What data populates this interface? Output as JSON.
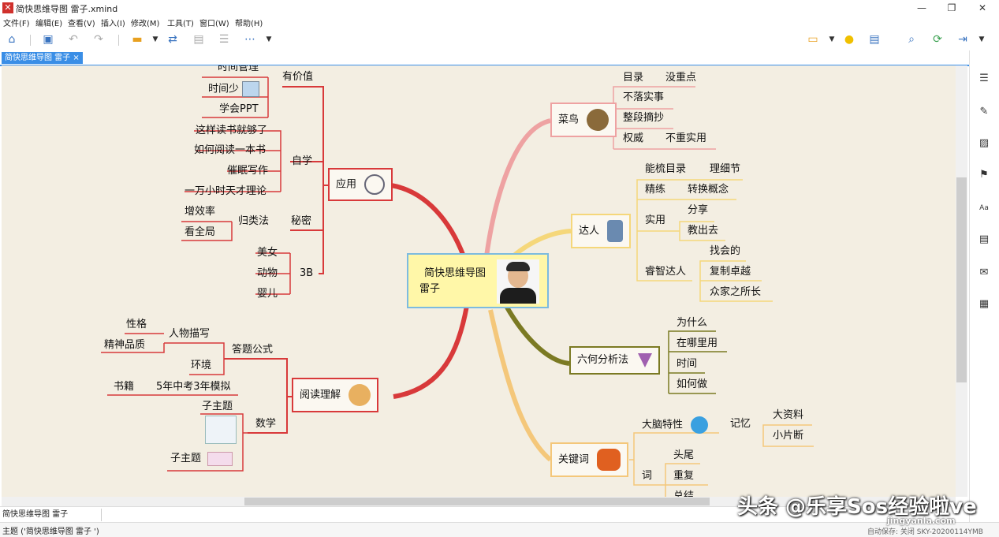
{
  "window": {
    "title": "简快思维导图 雷子.xmind",
    "app_icon": "xmind-icon"
  },
  "menu": [
    "文件(F)",
    "编辑(E)",
    "查看(V)",
    "插入(I)",
    "修改(M)",
    "工具(T)",
    "窗口(W)",
    "帮助(H)"
  ],
  "tab": {
    "label": "简快思维导图 雷子",
    "close": "×"
  },
  "central": {
    "line1": "简快思维导图",
    "line2": "雷子"
  },
  "left": {
    "youjiazhi": {
      "label": "有价值",
      "items": [
        "时间管理",
        "时间少",
        "学会PPT"
      ]
    },
    "zixue": {
      "label": "自学",
      "items": [
        "这样读书就够了",
        "如何阅读一本书",
        "催眠写作",
        "一万小时天才理论"
      ]
    },
    "mimi": {
      "label": "秘密",
      "sub": "归类法",
      "items": [
        "增效率",
        "看全局"
      ]
    },
    "threeb": {
      "label": "3B",
      "items": [
        "美女",
        "动物",
        "婴儿"
      ]
    },
    "yingyong": {
      "label": "应用"
    },
    "yuedu": {
      "label": "阅读理解"
    },
    "dati": {
      "label": "答题公式",
      "renwu": "人物描写",
      "renwu_items": [
        "性格",
        "精神品质"
      ],
      "huanjing": "环境"
    },
    "shuji": {
      "label": "书籍",
      "value": "5年中考3年模拟"
    },
    "shuxue": {
      "label": "数学",
      "items": [
        "子主题",
        "子主题"
      ]
    }
  },
  "right": {
    "cainiao": {
      "label": "菜鸟",
      "rows": [
        {
          "a": "目录",
          "b": "没重点"
        },
        {
          "a": "不落实事",
          "b": ""
        },
        {
          "a": "整段摘抄",
          "b": ""
        },
        {
          "a": "权威",
          "b": "不重实用"
        }
      ]
    },
    "daren": {
      "label": "达人",
      "nengshu": {
        "a": "能梳目录",
        "b": "理细节"
      },
      "jinglian": {
        "a": "精练",
        "b": "转换概念"
      },
      "shiyong": {
        "a": "实用",
        "items": [
          "分享",
          "教出去"
        ]
      },
      "ruizhi": {
        "a": "睿智达人",
        "items": [
          "找会的",
          "复制卓越",
          "众家之所长"
        ]
      }
    },
    "liuhe": {
      "label": "六何分析法",
      "items": [
        "为什么",
        "在哪里用",
        "时间",
        "如何做"
      ]
    },
    "guanjianci": {
      "label": "关键词",
      "danao": "大脑特性",
      "jiyi": "记忆",
      "jiyi_items": [
        "大资料",
        "小片断"
      ],
      "ci": "词",
      "ci_items": [
        "头尾",
        "重复",
        "总结"
      ]
    }
  },
  "sheet_tab": "简快思维导图 雷子",
  "status": {
    "left": "主题 ('简快思维导图 雷子            ')",
    "right": "自动保存: 关闭      SKY-20200114YMB"
  },
  "watermark": {
    "main": "头条 @乐享Sos经验啦ve",
    "site": "jingyanla.com"
  }
}
